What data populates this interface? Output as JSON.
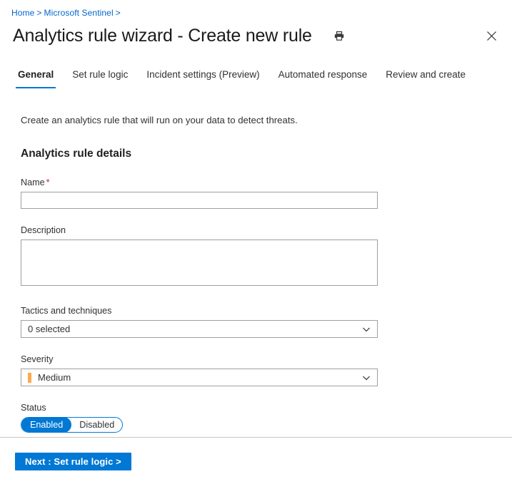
{
  "breadcrumb": {
    "items": [
      "Home",
      "Microsoft Sentinel"
    ],
    "separator": ">",
    "trailing_separator": ">"
  },
  "header": {
    "title": "Analytics rule wizard - Create new rule",
    "print_icon": "print-icon",
    "close_icon": "close-icon"
  },
  "tabs": [
    {
      "label": "General",
      "active": true
    },
    {
      "label": "Set rule logic",
      "active": false
    },
    {
      "label": "Incident settings (Preview)",
      "active": false
    },
    {
      "label": "Automated response",
      "active": false
    },
    {
      "label": "Review and create",
      "active": false
    }
  ],
  "main": {
    "intro": "Create an analytics rule that will run on your data to detect threats.",
    "section_title": "Analytics rule details",
    "name": {
      "label": "Name",
      "required_marker": "*",
      "value": "",
      "placeholder": ""
    },
    "description": {
      "label": "Description",
      "value": "",
      "placeholder": ""
    },
    "tactics": {
      "label": "Tactics and techniques",
      "value": "0 selected",
      "chevron_icon": "chevron-down-icon"
    },
    "severity": {
      "label": "Severity",
      "value": "Medium",
      "color": "#ffa94d",
      "chevron_icon": "chevron-down-icon"
    },
    "status": {
      "label": "Status",
      "options": [
        "Enabled",
        "Disabled"
      ],
      "selected": "Enabled"
    }
  },
  "footer": {
    "next_label": "Next : Set rule logic >"
  },
  "colors": {
    "accent": "#0078d4",
    "link": "#0066cc",
    "required": "#a4262c",
    "severity_medium": "#ffa94d"
  }
}
